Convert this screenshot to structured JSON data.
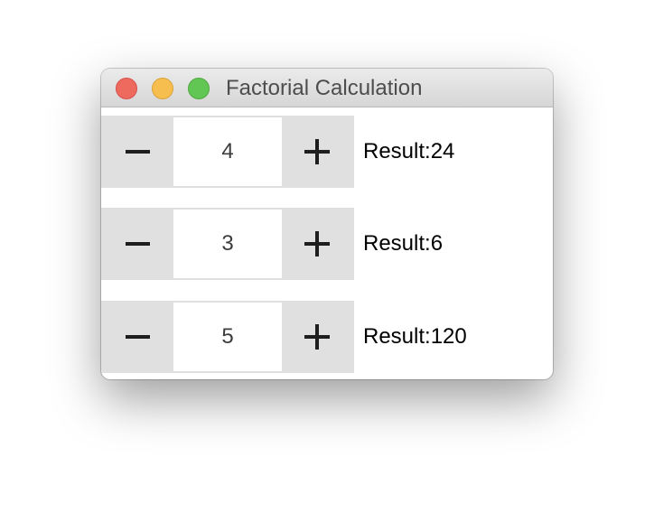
{
  "window": {
    "title": "Factorial Calculation"
  },
  "rows": [
    {
      "value": "4",
      "result": "Result:24"
    },
    {
      "value": "3",
      "result": "Result:6"
    },
    {
      "value": "5",
      "result": "Result:120"
    }
  ],
  "icons": {
    "decrement": "minus-icon",
    "increment": "plus-icon"
  },
  "colors": {
    "close": "#ee6a5f",
    "minimize": "#f6be4f",
    "maximize": "#62c655",
    "button_bg": "#e0e0e0"
  }
}
